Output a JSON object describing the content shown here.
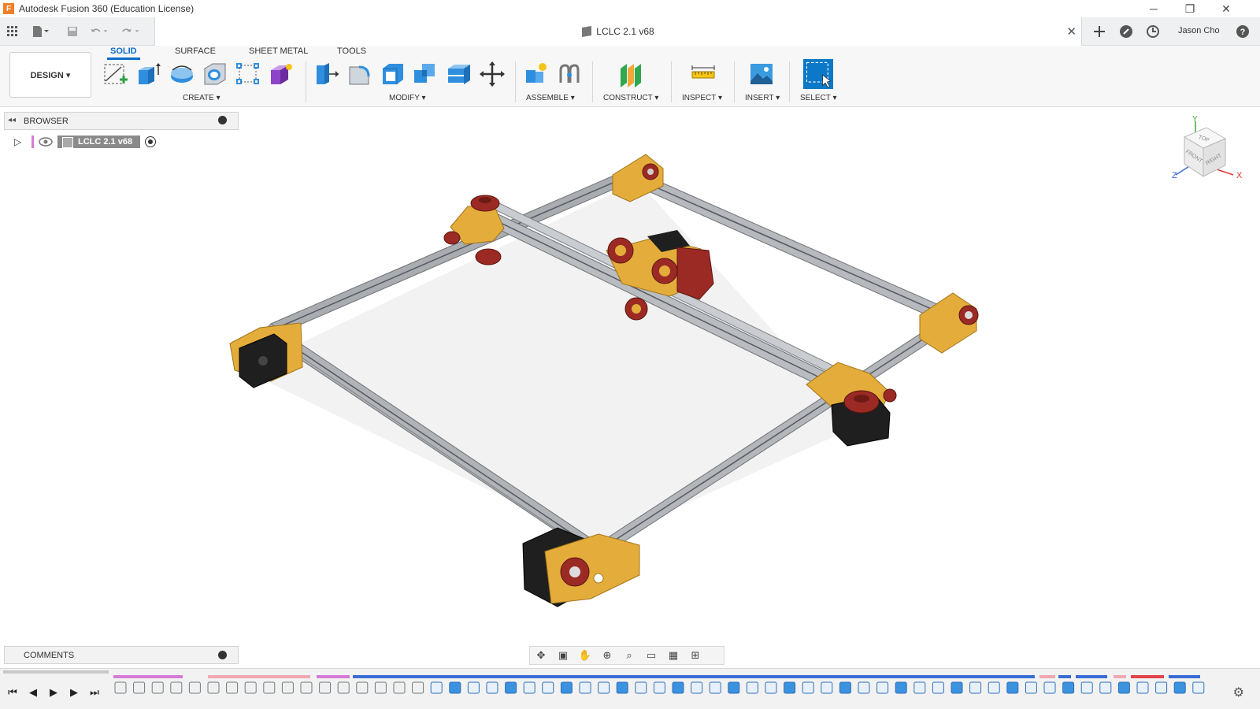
{
  "window": {
    "title": "Autodesk Fusion 360 (Education License)",
    "logo": "F",
    "controls": {
      "minimize": "─",
      "restore": "❐",
      "close": "✕"
    }
  },
  "quick_access": {
    "doc_title": "LCLC 2.1 v68",
    "doc_close": "✕",
    "user": "Jason Cho"
  },
  "design_button": "DESIGN ▾",
  "ribbon_tabs": [
    "SOLID",
    "SURFACE",
    "SHEET METAL",
    "TOOLS"
  ],
  "groups": {
    "create": "CREATE ▾",
    "modify": "MODIFY ▾",
    "assemble": "ASSEMBLE ▾",
    "construct": "CONSTRUCT ▾",
    "inspect": "INSPECT ▾",
    "insert": "INSERT ▾",
    "select": "SELECT ▾"
  },
  "browser": {
    "title": "BROWSER",
    "root_label": "LCLC 2.1 v68"
  },
  "comments": {
    "title": "COMMENTS"
  },
  "viewcube": {
    "top": "TOP",
    "front": "FRONT",
    "right": "RIGHT",
    "axis_x": "X",
    "axis_y": "Y",
    "axis_z": "Z"
  },
  "colors": {
    "accent": "#0b6bcb",
    "aluminum": "#b9bcbf",
    "bracket": "#e4ad3b",
    "wheel": "#9c2a24",
    "motor": "#1e1e1e"
  }
}
